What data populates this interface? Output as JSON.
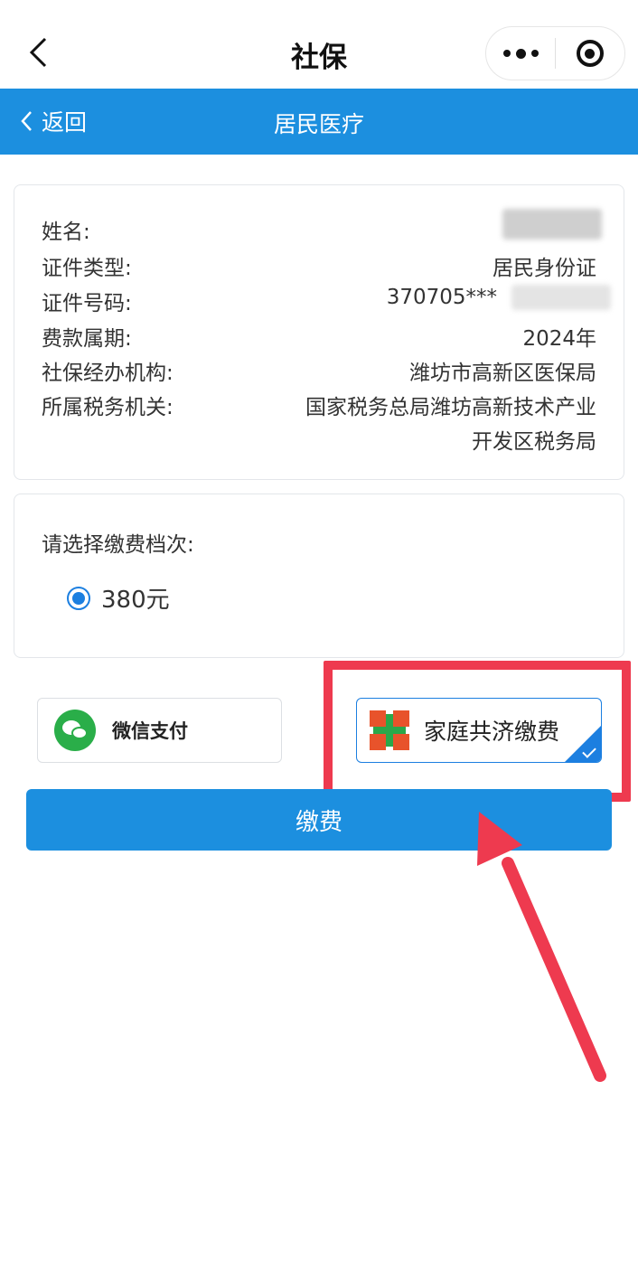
{
  "mini_nav": {
    "title": "社保",
    "icons": {
      "back": "chevron-left-icon",
      "more": "more-dots-icon",
      "close": "target-icon"
    }
  },
  "header": {
    "back_label": "返回",
    "title": "居民医疗"
  },
  "info": {
    "name_label": "姓名:",
    "id_type_label": "证件类型:",
    "id_type_value": "居民身份证",
    "id_no_label": "证件号码:",
    "id_no_value": "370705***",
    "period_label": "费款属期:",
    "period_value": "2024年",
    "agency_label": "社保经办机构:",
    "agency_value": "潍坊市高新区医保局",
    "tax_label": "所属税务机关:",
    "tax_value_line1": "国家税务总局潍坊高新技术产业",
    "tax_value_line2": "开发区税务局"
  },
  "tier": {
    "label": "请选择缴费档次:",
    "option": "380元",
    "selected": true
  },
  "payment": {
    "wechat_label": "微信支付",
    "family_label": "家庭共济缴费",
    "selected": "家庭共济缴费"
  },
  "pay_button_label": "缴费",
  "colors": {
    "primary": "#1c8fdf",
    "highlight": "#ee3a4f",
    "wechat": "#2aae49"
  }
}
